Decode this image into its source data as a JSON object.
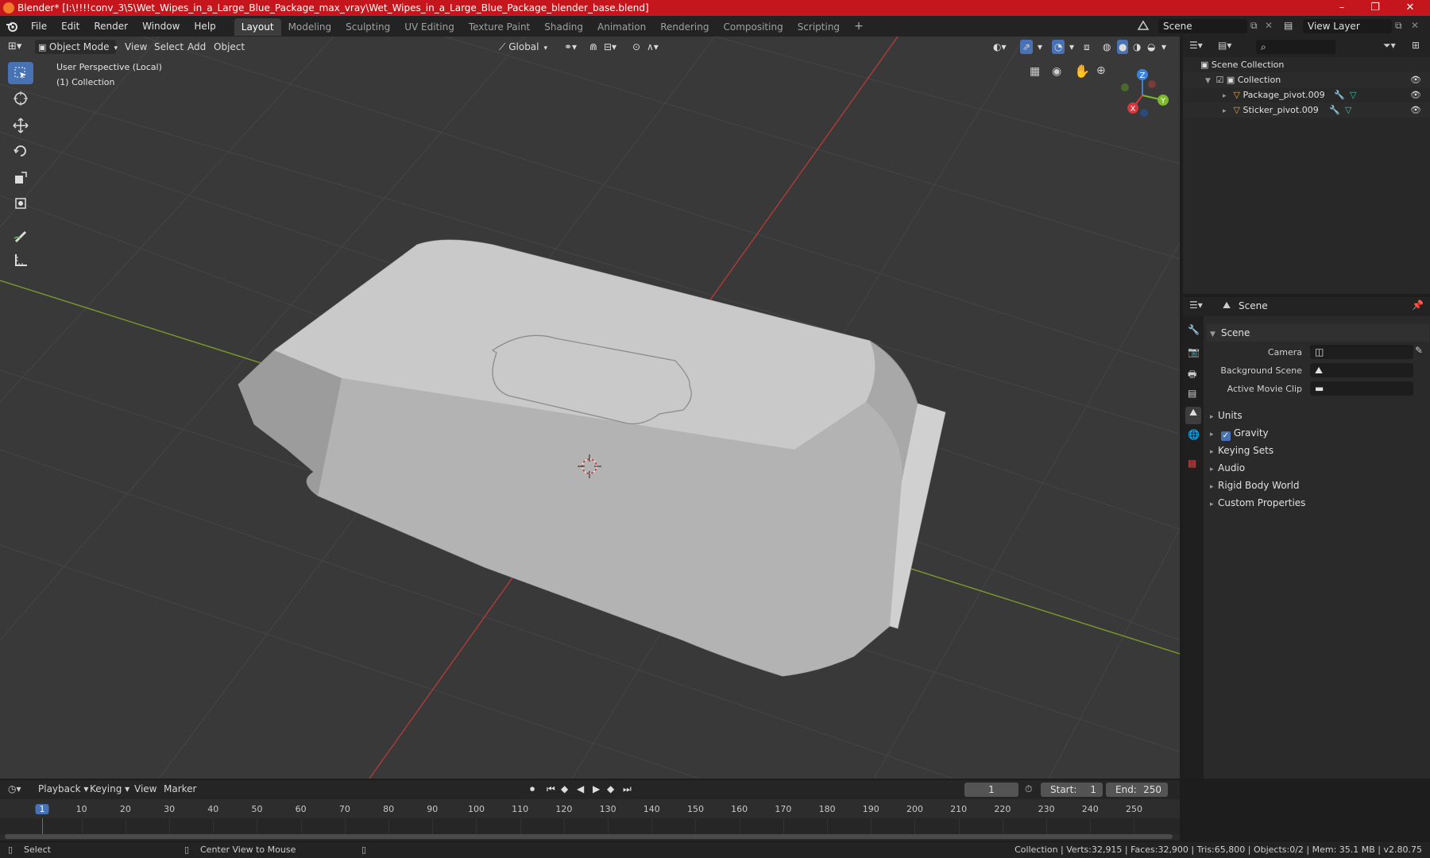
{
  "window": {
    "title": "Blender* [I:\\!!!!conv_3\\5\\Wet_Wipes_in_a_Large_Blue_Package_max_vray\\Wet_Wipes_in_a_Large_Blue_Package_blender_base.blend]",
    "minimize": "–",
    "maximize": "❐",
    "close": "✕"
  },
  "menu": [
    "File",
    "Edit",
    "Render",
    "Window",
    "Help"
  ],
  "workspaces": [
    {
      "label": "Layout",
      "active": true
    },
    {
      "label": "Modeling",
      "active": false
    },
    {
      "label": "Sculpting",
      "active": false
    },
    {
      "label": "UV Editing",
      "active": false
    },
    {
      "label": "Texture Paint",
      "active": false
    },
    {
      "label": "Shading",
      "active": false
    },
    {
      "label": "Animation",
      "active": false
    },
    {
      "label": "Rendering",
      "active": false
    },
    {
      "label": "Compositing",
      "active": false
    },
    {
      "label": "Scripting",
      "active": false
    }
  ],
  "add_workspace": "+",
  "scene_field": "Scene",
  "view_layer_field": "View Layer",
  "viewport": {
    "mode": "Object Mode",
    "menus": [
      "View",
      "Select",
      "Add",
      "Object"
    ],
    "orientation": "Global",
    "overlay_line1": "User Perspective (Local)",
    "overlay_line2": "(1) Collection",
    "gizmo": {
      "x": "X",
      "y": "Y",
      "z": "Z"
    }
  },
  "outliner": {
    "root": "Scene Collection",
    "collection": "Collection",
    "objects": [
      "Package_pivot.009",
      "Sticker_pivot.009"
    ]
  },
  "properties": {
    "header": "Scene",
    "panel_title": "Scene",
    "camera_label": "Camera",
    "background_scene_label": "Background Scene",
    "active_movie_clip_label": "Active Movie Clip",
    "subpanels": [
      "Units",
      "Gravity",
      "Keying Sets",
      "Audio",
      "Rigid Body World",
      "Custom Properties"
    ],
    "gravity_checked": true
  },
  "timeline": {
    "menus": [
      "Playback",
      "Keying",
      "View",
      "Marker"
    ],
    "current_frame": "1",
    "start_label": "Start:",
    "start_value": "1",
    "end_label": "End:",
    "end_value": "250",
    "ticks": [
      "1",
      "10",
      "20",
      "30",
      "40",
      "50",
      "60",
      "70",
      "80",
      "90",
      "100",
      "110",
      "120",
      "130",
      "140",
      "150",
      "160",
      "170",
      "180",
      "190",
      "200",
      "210",
      "220",
      "230",
      "240",
      "250"
    ]
  },
  "statusbar": {
    "select": "Select",
    "center_view": "Center View to Mouse",
    "stats": "Collection | Verts:32,915 | Faces:32,900 | Tris:65,800 | Objects:0/2 | Mem: 35.1 MB | v2.80.75"
  },
  "colors": {
    "title_bar": "#c4161c",
    "accent": "#4772b3",
    "axis_x": "#d6363c",
    "axis_y": "#7cb82b",
    "axis_z": "#3b82e0"
  }
}
